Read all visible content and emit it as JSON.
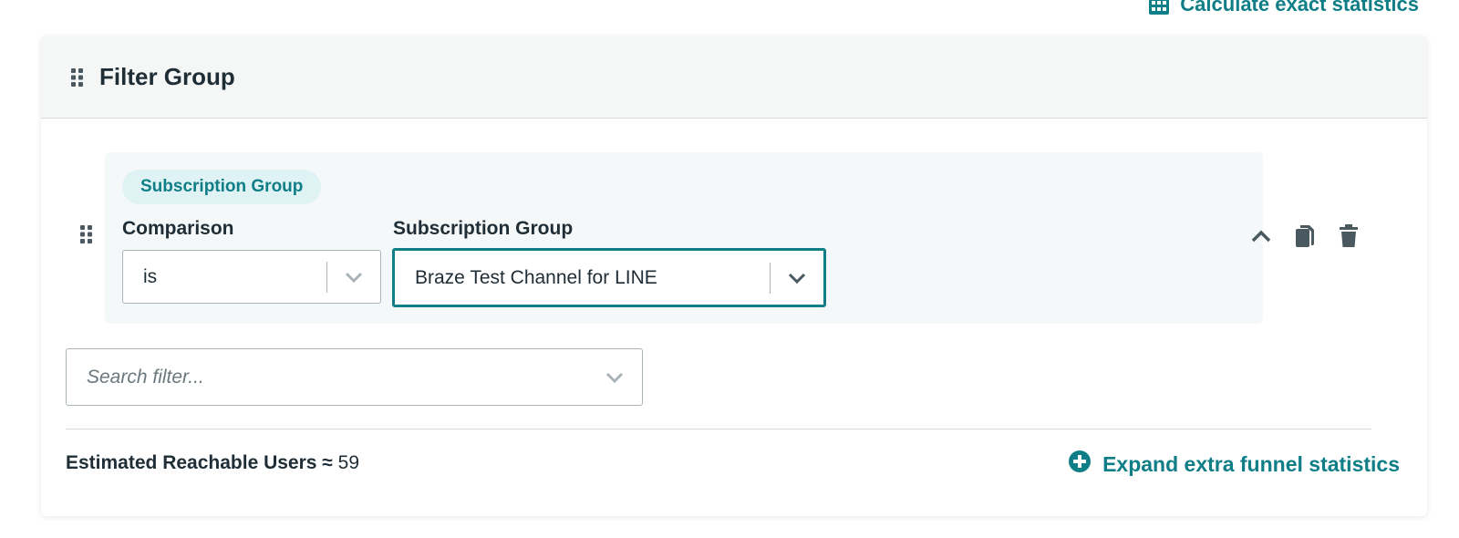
{
  "header_link": {
    "label": "Calculate exact statistics",
    "icon": "calculator-grid-icon"
  },
  "card": {
    "title": "Filter Group"
  },
  "filter": {
    "tag": "Subscription Group",
    "comparison_label": "Comparison",
    "comparison_value": "is",
    "group_label": "Subscription Group",
    "group_value": "Braze Test Channel for LINE"
  },
  "search": {
    "placeholder": "Search filter..."
  },
  "footer": {
    "estimate_label": "Estimated Reachable Users ≈",
    "estimate_value": "59",
    "expand_label": "Expand extra funnel statistics"
  },
  "colors": {
    "accent": "#0f7e87",
    "tag_bg": "#dff3f4",
    "text": "#1f2d36"
  }
}
